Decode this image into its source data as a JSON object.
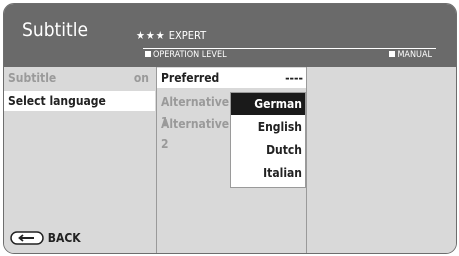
{
  "header": {
    "title": "Subtitle",
    "stars": "★★★",
    "level_name": "EXPERT",
    "operation_level_label": "OPERATION LEVEL",
    "mode_label": "MANUAL"
  },
  "menu": {
    "items": [
      {
        "label": "Subtitle",
        "value": "on",
        "state": "dimmed"
      },
      {
        "label": "Select language",
        "state": "selected"
      }
    ]
  },
  "submenu": {
    "items": [
      {
        "label": "Preferred",
        "value": "----",
        "state": "active"
      },
      {
        "label": "Alternative 1",
        "state": "dimmed"
      },
      {
        "label": "Alternative 2",
        "state": "dimmed"
      }
    ]
  },
  "language_dropdown": {
    "options": [
      "German",
      "English",
      "Dutch",
      "Italian"
    ],
    "selected": "German"
  },
  "footer": {
    "back_label": "BACK",
    "back_icon": "back-key-icon"
  }
}
